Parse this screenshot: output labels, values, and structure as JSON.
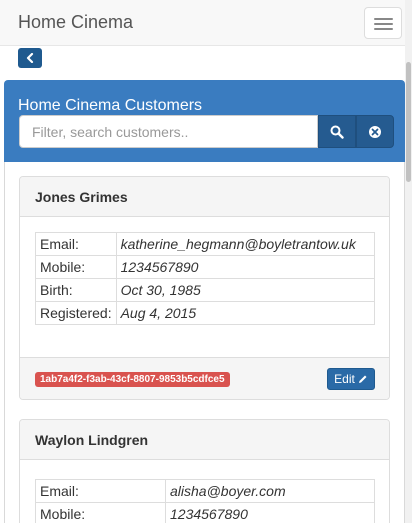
{
  "navbar": {
    "brand": "Home Cinema",
    "menu_icon": "hamburger-menu-icon"
  },
  "back_icon": "chevron-left-icon",
  "panel": {
    "title": "Home Cinema Customers",
    "search_placeholder": "Filter, search customers..",
    "search_icon": "search-icon",
    "clear_icon": "clear-circle-icon"
  },
  "customers": [
    {
      "name": "Jones Grimes",
      "fields": [
        {
          "label": "Email:",
          "value": "katherine_hegmann@boyletrantow.uk"
        },
        {
          "label": "Mobile:",
          "value": "1234567890"
        },
        {
          "label": "Birth:",
          "value": "Oct 30, 1985"
        },
        {
          "label": "Registered:",
          "value": "Aug 4, 2015"
        }
      ],
      "id": "1ab7a4f2-f3ab-43cf-8807-9853b5cdfce5",
      "edit_label": "Edit"
    },
    {
      "name": "Waylon Lindgren",
      "fields": [
        {
          "label": "Email:",
          "value": "alisha@boyer.com"
        },
        {
          "label": "Mobile:",
          "value": "1234567890"
        }
      ]
    }
  ],
  "colors": {
    "header": "#3a7cc0",
    "button": "#255b90",
    "badge": "#d9534f"
  }
}
